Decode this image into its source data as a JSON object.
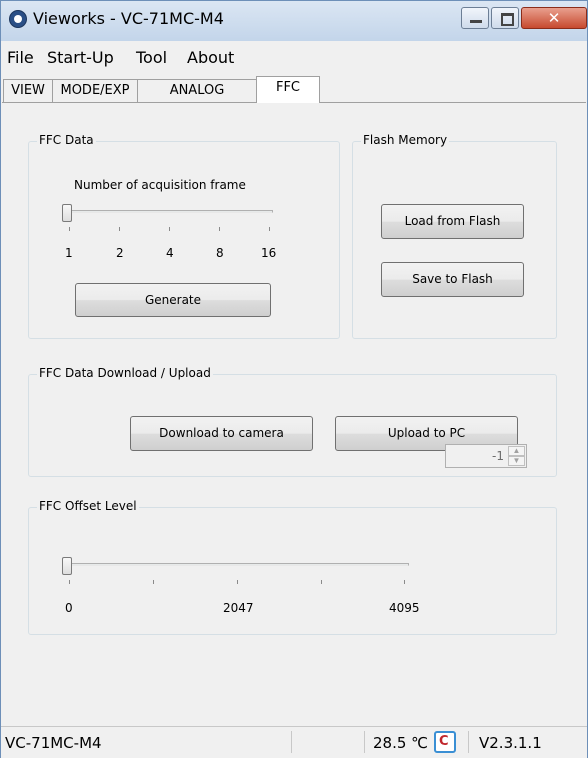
{
  "window": {
    "title": "Vieworks - VC-71MC-M4"
  },
  "menu": [
    "File",
    "Start-Up",
    "Tool",
    "About"
  ],
  "tabs": [
    "VIEW",
    "MODE/EXP",
    "ANALOG",
    "FFC"
  ],
  "active_tab": "FFC",
  "ffc_data": {
    "group_label": "FFC Data",
    "slider_label": "Number of acquisition frame",
    "tick_labels": [
      "1",
      "2",
      "4",
      "8",
      "16"
    ],
    "selected_value": "1",
    "generate_label": "Generate"
  },
  "flash_memory": {
    "group_label": "Flash Memory",
    "load_label": "Load from Flash",
    "save_label": "Save to Flash"
  },
  "download_upload": {
    "group_label": "FFC Data Download / Upload",
    "download_label": "Download to camera",
    "upload_label": "Upload to PC"
  },
  "offset_level": {
    "group_label": "FFC Offset Level",
    "tick_labels": [
      "0",
      "2047",
      "4095"
    ],
    "min": 0,
    "max": 4095,
    "slider_value": 0,
    "spin_value": "-1"
  },
  "status": {
    "model": "VC-71MC-M4",
    "temperature": "28.5 ℃",
    "temperature_icon": "thermometer-icon",
    "version": "V2.3.1.1"
  },
  "colors": {
    "title_bar": "#c3d5ea",
    "close_button": "#c74a2f",
    "window_bg": "#f0f0f0"
  }
}
